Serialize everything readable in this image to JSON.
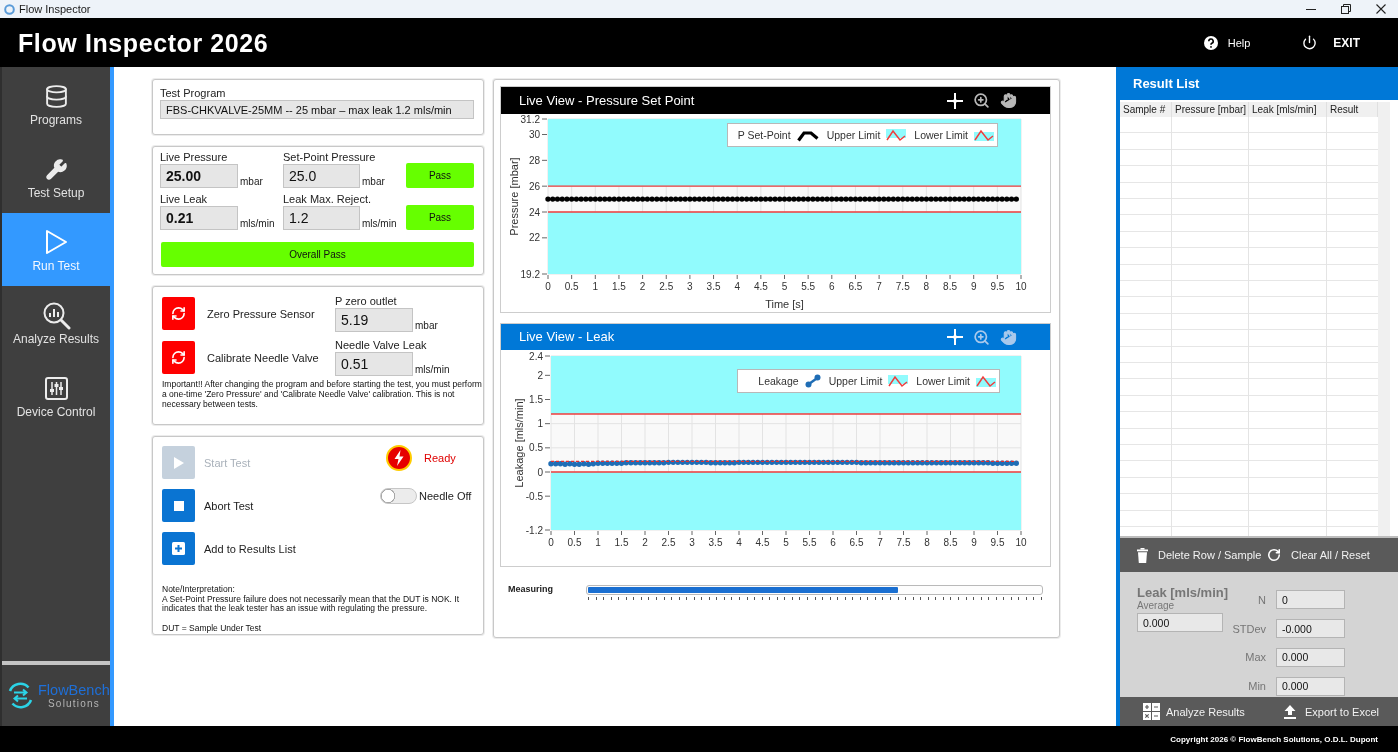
{
  "window": {
    "title": "Flow Inspector"
  },
  "header": {
    "title": "Flow Inspector 2026",
    "links": [
      {
        "label": "Help"
      },
      {
        "label": "EXIT"
      }
    ]
  },
  "sidebar": {
    "items": [
      {
        "label": "Programs",
        "selected": false
      },
      {
        "label": "Test Setup",
        "selected": false
      },
      {
        "label": "Run Test",
        "selected": true
      },
      {
        "label": "Analyze Results",
        "selected": false
      },
      {
        "label": "Device Control",
        "selected": false
      }
    ],
    "logo": {
      "name": "FlowBench",
      "tagline": "Solutions"
    }
  },
  "test_program": {
    "label": "Test Program",
    "value": "FBS-CHKVALVE-25MM -- 25 mbar – max leak 1.2 mls/min"
  },
  "measurements": {
    "rows": [
      {
        "live": {
          "label": "Live Pressure",
          "value": "25.00",
          "unit": "mbar"
        },
        "limit": {
          "label": "Set-Point Pressure",
          "value": "25.0",
          "unit": "mbar"
        },
        "status": {
          "label": "Pass",
          "passed": true
        }
      },
      {
        "live": {
          "label": "Live Leak",
          "value": "0.21",
          "unit": "mls/min"
        },
        "limit": {
          "label": "Leak Max. Reject.",
          "value": "1.2",
          "unit": "mls/min"
        },
        "status": {
          "label": "Pass",
          "passed": true
        }
      }
    ],
    "overall": {
      "label": "Overall Pass",
      "passed": true
    }
  },
  "calibration": {
    "items": [
      {
        "action": "Zero Pressure Sensor",
        "field_label": "P zero outlet",
        "value": "5.19",
        "unit": "mbar"
      },
      {
        "action": "Calibrate Needle Valve",
        "field_label": "Needle Valve Leak",
        "value": "0.51",
        "unit": "mls/min"
      }
    ],
    "note": "Important!! After changing the program and before starting the test, you must perform a one-time 'Zero Pressure' and 'Calibrate Needle Valve' calibration. This is not necessary between tests."
  },
  "test_control": {
    "buttons": [
      {
        "label": "Start Test",
        "disabled": true
      },
      {
        "label": "Abort Test",
        "disabled": false
      },
      {
        "label": "Add to Results List",
        "disabled": false
      }
    ],
    "status": {
      "label": "Ready"
    },
    "needle": {
      "label": "Needle Off",
      "on": false
    },
    "notes": {
      "heading": "Note/Interpretation:",
      "text": "A Set-Point Pressure failure does not necessarily mean that the DUT is NOK. It indicates that the leak tester has an issue with regulating the pressure.",
      "footnote": "DUT = Sample Under Test"
    }
  },
  "live_view": {
    "charts": [
      {
        "title": "Live View - Pressure Set Point",
        "selected": false,
        "tools": [
          {
            "selected": true
          },
          {
            "selected": false
          },
          {
            "selected": false
          }
        ],
        "chart_data": {
          "type": "line",
          "xlabel": "Time [s]",
          "ylabel": "Pressure [mbar]",
          "xlim": [
            0,
            10
          ],
          "ylim": [
            19.2,
            31.2
          ],
          "xticks": [
            0,
            0.5,
            1,
            1.5,
            2,
            2.5,
            3,
            3.5,
            4,
            4.5,
            5,
            5.5,
            6,
            6.5,
            7,
            7.5,
            8,
            8.5,
            9,
            9.5,
            10
          ],
          "yticks": [
            19.2,
            22,
            24,
            26,
            28,
            30,
            31.2
          ],
          "grid": true,
          "legend": true,
          "x": [
            0,
            0.1,
            0.2,
            0.3,
            0.4,
            0.5,
            0.6,
            0.7,
            0.8,
            0.9,
            1,
            1.1,
            1.2,
            1.3,
            1.4,
            1.5,
            1.6,
            1.7,
            1.8,
            1.9,
            2,
            2.1,
            2.2,
            2.3,
            2.4,
            2.5,
            2.6,
            2.7,
            2.8,
            2.9,
            3,
            3.1,
            3.2,
            3.3,
            3.4,
            3.5,
            3.6,
            3.7,
            3.8,
            3.9,
            4,
            4.1,
            4.2,
            4.3,
            4.4,
            4.5,
            4.6,
            4.7,
            4.8,
            4.9,
            5,
            5.1,
            5.2,
            5.3,
            5.4,
            5.5,
            5.6,
            5.7,
            5.8,
            5.9,
            6,
            6.1,
            6.2,
            6.3,
            6.4,
            6.5,
            6.6,
            6.7,
            6.8,
            6.9,
            7,
            7.1,
            7.2,
            7.3,
            7.4,
            7.5,
            7.6,
            7.7,
            7.8,
            7.9,
            8,
            8.1,
            8.2,
            8.3,
            8.4,
            8.5,
            8.6,
            8.7,
            8.8,
            8.9,
            9,
            9.1,
            9.2,
            9.3,
            9.4,
            9.5,
            9.6,
            9.7,
            9.8,
            9.9
          ],
          "series": [
            {
              "name": "P Set-Point",
              "color": "#000000",
              "values": [
                25,
                25,
                25,
                25,
                25,
                25,
                25,
                25,
                25,
                25,
                25,
                25,
                25,
                25,
                25,
                25,
                25,
                25,
                25,
                25,
                25,
                25,
                25,
                25,
                25,
                25,
                25,
                25,
                25,
                25,
                25,
                25,
                25,
                25,
                25,
                25,
                25,
                25,
                25,
                25,
                25,
                25,
                25,
                25,
                25,
                25,
                25,
                25,
                25,
                25,
                25,
                25,
                25,
                25,
                25,
                25,
                25,
                25,
                25,
                25,
                25,
                25,
                25,
                25,
                25,
                25,
                25,
                25,
                25,
                25,
                25,
                25,
                25,
                25,
                25,
                25,
                25,
                25,
                25,
                25,
                25,
                25,
                25,
                25,
                25,
                25,
                25,
                25,
                25,
                25,
                25,
                25,
                25,
                25,
                25,
                25,
                25,
                25,
                25,
                25
              ]
            }
          ],
          "ref_lines": [
            {
              "axis": "y",
              "value": 26,
              "label": "Upper Limit",
              "color": "#f03c3c"
            },
            {
              "axis": "y",
              "value": 24,
              "label": "Lower Limit",
              "color": "#f03c3c"
            }
          ],
          "bands": [
            {
              "axis": "y",
              "from": 26,
              "to": 31.2,
              "color": "#91fbfd"
            },
            {
              "axis": "y",
              "from": 19.2,
              "to": 24,
              "color": "#91fbfd"
            }
          ]
        }
      },
      {
        "title": "Live View - Leak",
        "selected": true,
        "tools": [
          {
            "selected": true
          },
          {
            "selected": false
          },
          {
            "selected": false
          }
        ],
        "chart_data": {
          "type": "line",
          "ylabel": "Leakage [mls/min]",
          "xlim": [
            0,
            10
          ],
          "ylim": [
            -1.2,
            2.4
          ],
          "xticks": [
            0,
            0.5,
            1,
            1.5,
            2,
            2.5,
            3,
            3.5,
            4,
            4.5,
            5,
            5.5,
            6,
            6.5,
            7,
            7.5,
            8,
            8.5,
            9,
            9.5,
            10
          ],
          "yticks": [
            -1.2,
            -0.5,
            0,
            0.5,
            1,
            1.5,
            2,
            2.4
          ],
          "grid": true,
          "legend": true,
          "x": [
            0,
            0.1,
            0.2,
            0.3,
            0.4,
            0.5,
            0.6,
            0.7,
            0.8,
            0.9,
            1,
            1.1,
            1.2,
            1.3,
            1.4,
            1.5,
            1.6,
            1.7,
            1.8,
            1.9,
            2,
            2.1,
            2.2,
            2.3,
            2.4,
            2.5,
            2.6,
            2.7,
            2.8,
            2.9,
            3,
            3.1,
            3.2,
            3.3,
            3.4,
            3.5,
            3.6,
            3.7,
            3.8,
            3.9,
            4,
            4.1,
            4.2,
            4.3,
            4.4,
            4.5,
            4.6,
            4.7,
            4.8,
            4.9,
            5,
            5.1,
            5.2,
            5.3,
            5.4,
            5.5,
            5.6,
            5.7,
            5.8,
            5.9,
            6,
            6.1,
            6.2,
            6.3,
            6.4,
            6.5,
            6.6,
            6.7,
            6.8,
            6.9,
            7,
            7.1,
            7.2,
            7.3,
            7.4,
            7.5,
            7.6,
            7.7,
            7.8,
            7.9,
            8,
            8.1,
            8.2,
            8.3,
            8.4,
            8.5,
            8.6,
            8.7,
            8.8,
            8.9,
            9,
            9.1,
            9.2,
            9.3,
            9.4,
            9.5,
            9.6,
            9.7,
            9.8,
            9.9
          ],
          "series": [
            {
              "name": "Leakage",
              "color": "#1f6db5",
              "values": [
                0.17,
                0.17,
                0.17,
                0.16,
                0.17,
                0.16,
                0.16,
                0.17,
                0.16,
                0.17,
                0.18,
                0.18,
                0.18,
                0.18,
                0.18,
                0.18,
                0.19,
                0.19,
                0.19,
                0.19,
                0.19,
                0.19,
                0.19,
                0.19,
                0.19,
                0.2,
                0.2,
                0.2,
                0.2,
                0.2,
                0.2,
                0.2,
                0.2,
                0.2,
                0.19,
                0.19,
                0.19,
                0.19,
                0.19,
                0.19,
                0.2,
                0.2,
                0.2,
                0.2,
                0.2,
                0.2,
                0.2,
                0.2,
                0.2,
                0.2,
                0.2,
                0.2,
                0.2,
                0.2,
                0.2,
                0.2,
                0.2,
                0.2,
                0.2,
                0.2,
                0.2,
                0.2,
                0.2,
                0.2,
                0.2,
                0.2,
                0.19,
                0.19,
                0.19,
                0.19,
                0.19,
                0.19,
                0.19,
                0.19,
                0.19,
                0.19,
                0.19,
                0.19,
                0.19,
                0.19,
                0.19,
                0.19,
                0.19,
                0.19,
                0.19,
                0.19,
                0.19,
                0.19,
                0.19,
                0.19,
                0.19,
                0.19,
                0.19,
                0.19,
                0.18,
                0.18,
                0.18,
                0.18,
                0.18,
                0.18
              ]
            },
            {
              "color": "#e03030",
              "line_style": "dashed",
              "values": [
                0.22,
                0.22,
                0.22,
                0.22,
                0.22,
                0.22,
                0.22,
                0.22,
                0.22,
                0.22,
                0.22,
                0.22,
                0.22,
                0.22,
                0.22,
                0.22,
                0.22,
                0.22,
                0.22,
                0.22,
                0.22,
                0.22,
                0.22,
                0.22,
                0.22,
                0.22,
                0.22,
                0.22,
                0.22,
                0.22,
                0.22,
                0.22,
                0.22,
                0.22,
                0.22,
                0.22,
                0.22,
                0.22,
                0.22,
                0.22,
                0.22,
                0.22,
                0.22,
                0.22,
                0.22,
                0.22,
                0.22,
                0.22,
                0.22,
                0.22,
                0.22,
                0.22,
                0.22,
                0.22,
                0.22,
                0.22,
                0.22,
                0.22,
                0.22,
                0.22,
                0.22,
                0.22,
                0.22,
                0.22,
                0.22,
                0.22,
                0.22,
                0.22,
                0.22,
                0.22,
                0.22,
                0.22,
                0.22,
                0.22,
                0.22,
                0.22,
                0.22,
                0.22,
                0.22,
                0.22,
                0.22,
                0.22,
                0.22,
                0.22,
                0.22,
                0.22,
                0.22,
                0.22,
                0.22,
                0.22,
                0.22,
                0.22,
                0.22,
                0.22,
                0.22,
                0.22,
                0.22,
                0.22,
                0.22,
                0.22
              ]
            }
          ],
          "ref_lines": [
            {
              "axis": "y",
              "value": 1.2,
              "label": "Upper Limit",
              "color": "#f03c3c"
            },
            {
              "axis": "y",
              "value": 0,
              "label": "Lower Limit",
              "color": "#f03c3c"
            }
          ],
          "bands": [
            {
              "axis": "y",
              "from": 1.2,
              "to": 2.4,
              "color": "#91fbfd"
            },
            {
              "axis": "y",
              "from": -1.2,
              "to": 0,
              "color": "#91fbfd"
            }
          ]
        }
      }
    ],
    "progress": {
      "label": "Measuring",
      "level": 0.685
    }
  },
  "results": {
    "title": "Result List",
    "columns": [
      "Sample #",
      "Pressure [mbar]",
      "Leak [mls/min]",
      "Result"
    ],
    "actions": [
      {
        "label": "Delete Row / Sample"
      },
      {
        "label": "Clear All / Reset"
      }
    ],
    "stats": {
      "title": "Leak [mls/min]",
      "subtitle": "Average",
      "average": "0.000",
      "fields": [
        {
          "label": "N",
          "value": "0"
        },
        {
          "label": "STDev",
          "value": "-0.000"
        },
        {
          "label": "Max",
          "value": "0.000"
        },
        {
          "label": "Min",
          "value": "0.000"
        }
      ]
    },
    "footer_actions": [
      {
        "label": "Analyze Results"
      },
      {
        "label": "Export to Excel"
      }
    ]
  },
  "footer": {
    "copyright": "Copyright 2026 © FlowBench Solutions, O.D.L. Dupont"
  }
}
